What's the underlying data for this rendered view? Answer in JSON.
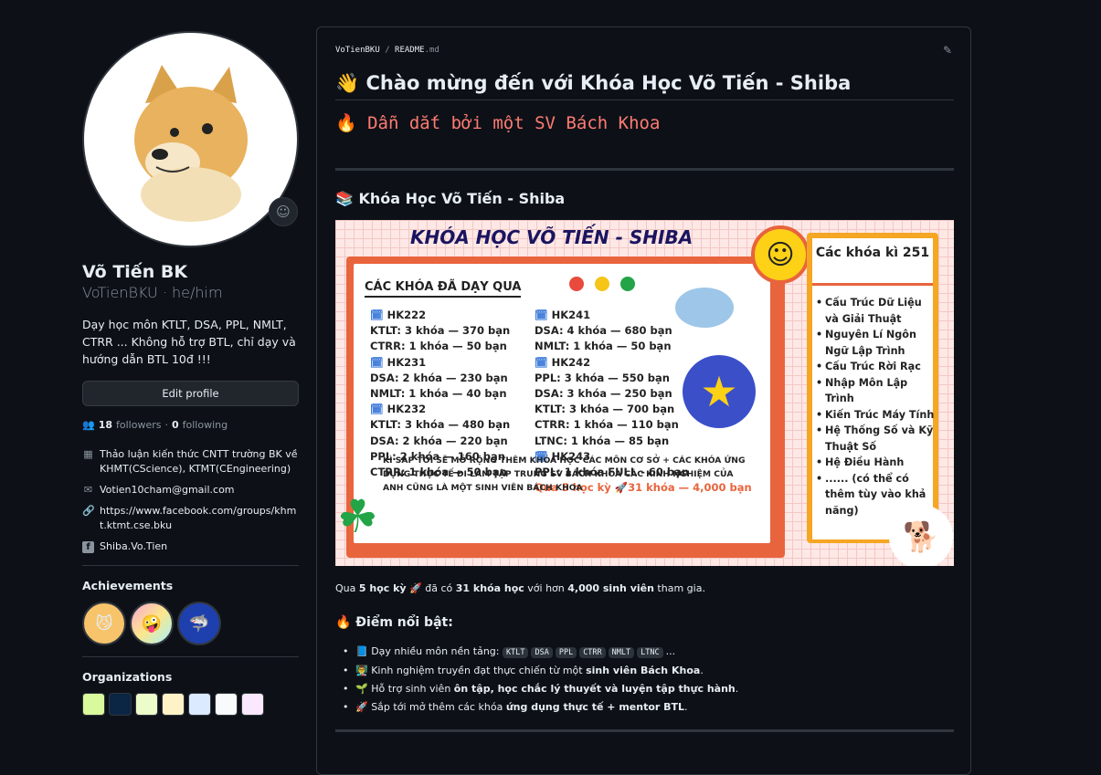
{
  "profile": {
    "name": "Võ Tiến BK",
    "login_pronoun": "VoTienBKU · he/him",
    "bio": "Dạy học môn KTLT, DSA, PPL, NMLT, CTRR ... Không hỗ trợ BTL, chỉ dạy và hướng dẫn BTL 10đ !!!",
    "edit_label": "Edit profile",
    "followers_count": "18",
    "followers_label": "followers",
    "following_count": "0",
    "following_label": "following",
    "details": {
      "org": "Thảo luận kiến thức CNTT trường BK về KHMT(CScience), KTMT(CEngineering)",
      "email": "Votien10cham@gmail.com",
      "link": "https://www.facebook.com/groups/khmt.ktmt.cse.bku",
      "facebook": "Shiba.Vo.Tien"
    },
    "achievements_title": "Achievements",
    "organizations_title": "Organizations"
  },
  "readme": {
    "crumb_user": "VoTienBKU",
    "crumb_sep": "/",
    "crumb_file": "README",
    "crumb_ext": ".md",
    "h1": "👋 Chào mừng đến với Khóa Học Võ Tiến - Shiba",
    "sub": "🔥 Dẫn dắt bởi một SV Bách Khoa",
    "h2": "📚 Khóa Học Võ Tiến - Shiba",
    "summary": {
      "pre": "Qua ",
      "a": "5 học kỳ",
      "b": " 🚀 đã có ",
      "c": "31 khóa học",
      "d": " với hơn ",
      "e": "4,000 sinh viên",
      "f": " tham gia."
    },
    "h3": "🔥 Điểm nổi bật:",
    "points": {
      "p1_pre": "📘 Dạy nhiều môn nền tảng: ",
      "codes": [
        "KTLT",
        "DSA",
        "PPL",
        "CTRR",
        "NMLT",
        "LTNC"
      ],
      "p1_post": "...",
      "p2_pre": "👨‍🏫 Kinh nghiệm truyền đạt thực chiến từ một ",
      "p2_bold": "sinh viên Bách Khoa",
      "p2_post": ".",
      "p3_pre": "🌱 Hỗ trợ sinh viên ",
      "p3_bold": "ôn tập, học chắc lý thuyết và luyện tập thực hành",
      "p3_post": ".",
      "p4_pre": "🚀 Sắp tới mở thêm các khóa ",
      "p4_bold": "ứng dụng thực tế + mentor BTL",
      "p4_post": "."
    }
  },
  "banner": {
    "title": "KHÓA HỌC VÕ TIẾN - SHIBA",
    "head": "CÁC KHÓA ĐÃ DẠY QUA",
    "left_col": [
      {
        "hk": "HK222",
        "lines": [
          "KTLT: 3 khóa — 370 bạn",
          "CTRR: 1 khóa — 50 bạn"
        ]
      },
      {
        "hk": "HK231",
        "lines": [
          "DSA: 2 khóa — 230 bạn",
          "NMLT: 1 khóa — 40 bạn"
        ]
      },
      {
        "hk": "HK232",
        "lines": [
          "KTLT: 3 khóa — 480 bạn",
          "DSA: 2 khóa — 220 bạn",
          "PPL: 2 khóa — 160 bạn",
          "CTRR: 1 khóa — 50 bạn"
        ]
      }
    ],
    "right_col": [
      {
        "hk": "HK241",
        "lines": [
          "DSA: 4 khóa — 680 bạn",
          "NMLT: 1 khóa — 50 bạn"
        ]
      },
      {
        "hk": "HK242",
        "lines": [
          "PPL: 3 khóa — 550 bạn",
          "DSA: 3 khóa — 250 bạn",
          "KTLT: 3 khóa — 700 bạn",
          "CTRR: 1 khóa — 110 bạn",
          "LTNC: 1 khóa — 85 bạn"
        ]
      },
      {
        "hk": "HK243",
        "lines": [
          "PPL: 1 khóa FULL  - 60 bạn"
        ]
      }
    ],
    "total": "Qua 5 học kỳ 🚀31 khóa — 4,000 bạn",
    "footer": "KÌ SẮP TỚI SẼ MỞ RỘNG THÊM KHÓA HỌC CÁC MÔN CƠ SỞ + CÁC KHÓA ỨNG DỤNG THỰC TẾ ĐI LÀM TẬP TRUNG SV BÁCH KHOA CÁC KINH NGHIỆM CỦA ANH CŨNG LÀ MỘT SINH VIÊN BÁCH KHOA",
    "side_title": "Các khóa kì 251",
    "side_items": [
      "Cấu Trúc Dữ Liệu và Giải Thuật",
      "Nguyên Lí Ngôn Ngữ Lập Trình",
      "Cấu Trúc Rời Rạc",
      "Nhập Môn Lập Trình",
      "Kiến Trúc Máy Tính",
      "Hệ Thống Số và Kỹ Thuật Số",
      "Hệ Điều Hành",
      "...... (có thể có thêm tùy vào khả năng)"
    ]
  },
  "colors": {
    "bg": "#0d1117",
    "border": "#30363d",
    "accent_red": "#ff7b72",
    "banner_orange": "#e8643c",
    "banner_yellow": "#f5a623"
  },
  "icons": {
    "people": "people-icon",
    "org": "organization-icon",
    "mail": "mail-icon",
    "link": "link-icon",
    "facebook": "facebook-icon",
    "pencil": "pencil-icon",
    "smiley": "smiley-icon"
  }
}
